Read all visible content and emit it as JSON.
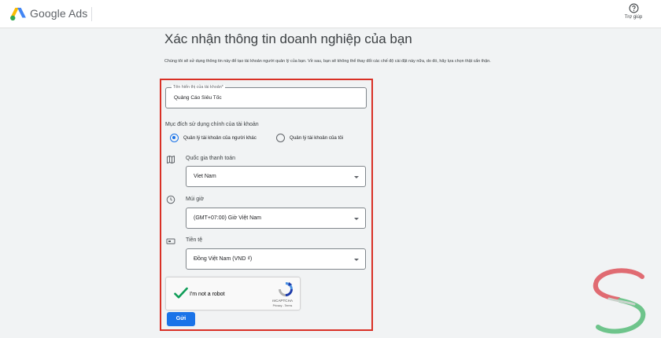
{
  "header": {
    "logo_text": "Google Ads",
    "help_label": "Trợ giúp",
    "icons": {
      "logo": "google-ads-logo",
      "help": "help-circle-icon"
    }
  },
  "page": {
    "title": "Xác nhận thông tin doanh nghiệp của bạn",
    "intro": "Chúng tôi sẽ sử dụng thông tin này để tạo tài khoản người quản lý của bạn. Về sau, bạn sẽ không thể thay đổi các chế độ cài đặt này nữa, do đó, hãy lựa chọn thật cẩn thận."
  },
  "form": {
    "account_name": {
      "label": "Tên hiển thị của tài khoản*",
      "value": "Quảng Cáo Siêu Tốc"
    },
    "purpose": {
      "title": "Mục đích sử dụng chính của tài khoản",
      "options": [
        {
          "label": "Quản lý tài khoản của người khác",
          "selected": true
        },
        {
          "label": "Quản lý tài khoản của tôi",
          "selected": false
        }
      ]
    },
    "billing_country": {
      "label": "Quốc gia thanh toán",
      "value": "Viet Nam",
      "icon": "map-icon"
    },
    "timezone": {
      "label": "Múi giờ",
      "value": "(GMT+07:00) Giờ Việt Nam",
      "icon": "clock-icon"
    },
    "currency": {
      "label": "Tiền tệ",
      "value": "Đồng Việt Nam (VND ₫)",
      "icon": "currency-icon"
    },
    "captcha": {
      "text": "I'm not a robot",
      "brand": "reCAPTCHA",
      "links": "Privacy - Terms",
      "checked": true
    },
    "submit_label": "Gửi"
  },
  "colors": {
    "accent": "#1a73e8",
    "highlight_frame": "#d93025",
    "check": "#0f9d58"
  }
}
